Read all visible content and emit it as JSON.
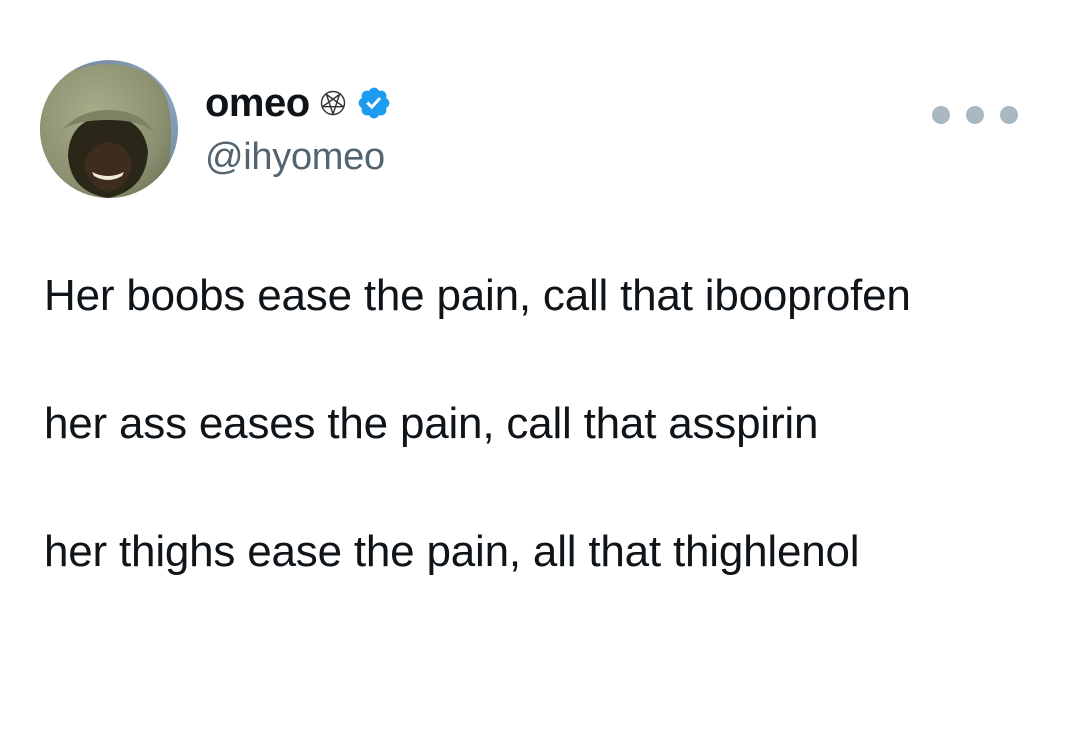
{
  "tweet": {
    "author": {
      "display_name": "omeo",
      "name_emoji": "pentagram-icon",
      "verified": true,
      "verified_color": "#1d9bf0",
      "handle": "@ihyomeo",
      "avatar": "hooded-figure-avatar"
    },
    "more_options_icon": "more-dots-icon",
    "body_lines": [
      "Her boobs ease the pain, call that ibooprofen",
      "her ass eases the pain, call that asspirin",
      "her thighs ease the pain, all that thighlenol"
    ]
  }
}
